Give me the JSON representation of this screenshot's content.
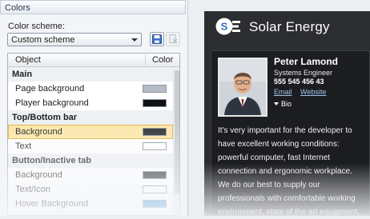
{
  "panel": {
    "title": "Colors"
  },
  "scheme": {
    "label": "Color scheme:",
    "value": "Custom scheme"
  },
  "grid": {
    "col_object": "Object",
    "col_color": "Color",
    "rows": [
      {
        "type": "category",
        "label": "Main"
      },
      {
        "type": "item",
        "label": "Page background",
        "color": "#b4bcc8"
      },
      {
        "type": "item",
        "label": "Player background",
        "color": "#111216"
      },
      {
        "type": "category",
        "label": "Top/Bottom bar"
      },
      {
        "type": "item",
        "label": "Background",
        "color": "#2f3033",
        "selected": true
      },
      {
        "type": "item",
        "label": "Text",
        "color": "#ffffff"
      },
      {
        "type": "category",
        "label": "Button/Inactive tab"
      },
      {
        "type": "item",
        "label": "Background",
        "color": "#2a2c31"
      },
      {
        "type": "item",
        "label": "Text/Icon",
        "color": "#ffffff"
      },
      {
        "type": "item",
        "label": "Hover Background",
        "color": "#3a93e0"
      }
    ]
  },
  "player": {
    "brand": "Solar Energy",
    "name": "Peter Lamond",
    "role": "Systems Engineer",
    "phone": "555 545 456 43",
    "email_label": "Email",
    "website_label": "Website",
    "bio_label": "Bio",
    "bio_lines": [
      "It's very important for the developer to",
      "have excellent working conditions:",
      "powerful computer, fast Internet",
      "connection and ergonomic workplace.",
      "We do our best to supply our",
      "professionals with comfortable working",
      "environment, state of the art equipment,"
    ]
  }
}
